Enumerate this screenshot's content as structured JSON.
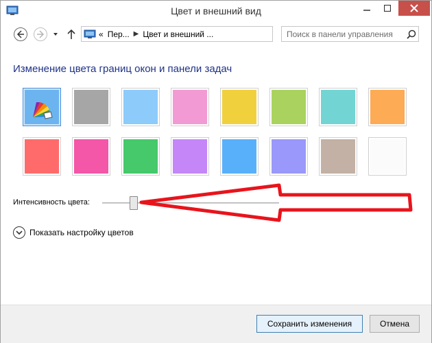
{
  "window": {
    "title": "Цвет и внешний вид",
    "accent": "#c7504a"
  },
  "navbar": {
    "breadcrumb_prefix": "«",
    "breadcrumb_1": "Пер...",
    "breadcrumb_2": "Цвет и внешний ...",
    "search_placeholder": "Поиск в панели управления"
  },
  "heading": "Изменение цвета границ окон и панели задач",
  "swatches": [
    {
      "name": "color-picker",
      "color": "#6cb4f0",
      "selected": true
    },
    {
      "name": "gray",
      "color": "#a6a6a6"
    },
    {
      "name": "light-blue",
      "color": "#8dcbfb"
    },
    {
      "name": "pink",
      "color": "#f29ad3"
    },
    {
      "name": "yellow",
      "color": "#f1d03e"
    },
    {
      "name": "lime",
      "color": "#a9d35e"
    },
    {
      "name": "teal",
      "color": "#72d5d4"
    },
    {
      "name": "orange",
      "color": "#fdab54"
    },
    {
      "name": "red",
      "color": "#ff6b6b"
    },
    {
      "name": "magenta",
      "color": "#f456a8"
    },
    {
      "name": "green",
      "color": "#45c96a"
    },
    {
      "name": "violet",
      "color": "#c586f7"
    },
    {
      "name": "blue",
      "color": "#59b0fa"
    },
    {
      "name": "periwinkle",
      "color": "#9a98fa"
    },
    {
      "name": "taupe",
      "color": "#c2b1a4"
    },
    {
      "name": "white",
      "color": "#fbfbfb"
    }
  ],
  "intensity": {
    "label": "Интенсивность цвета:",
    "value_fraction": 0.18
  },
  "expand": {
    "label": "Показать настройку цветов"
  },
  "footer": {
    "save_label": "Сохранить изменения",
    "cancel_label": "Отмена"
  },
  "annotation": {
    "color": "#e8141c"
  }
}
